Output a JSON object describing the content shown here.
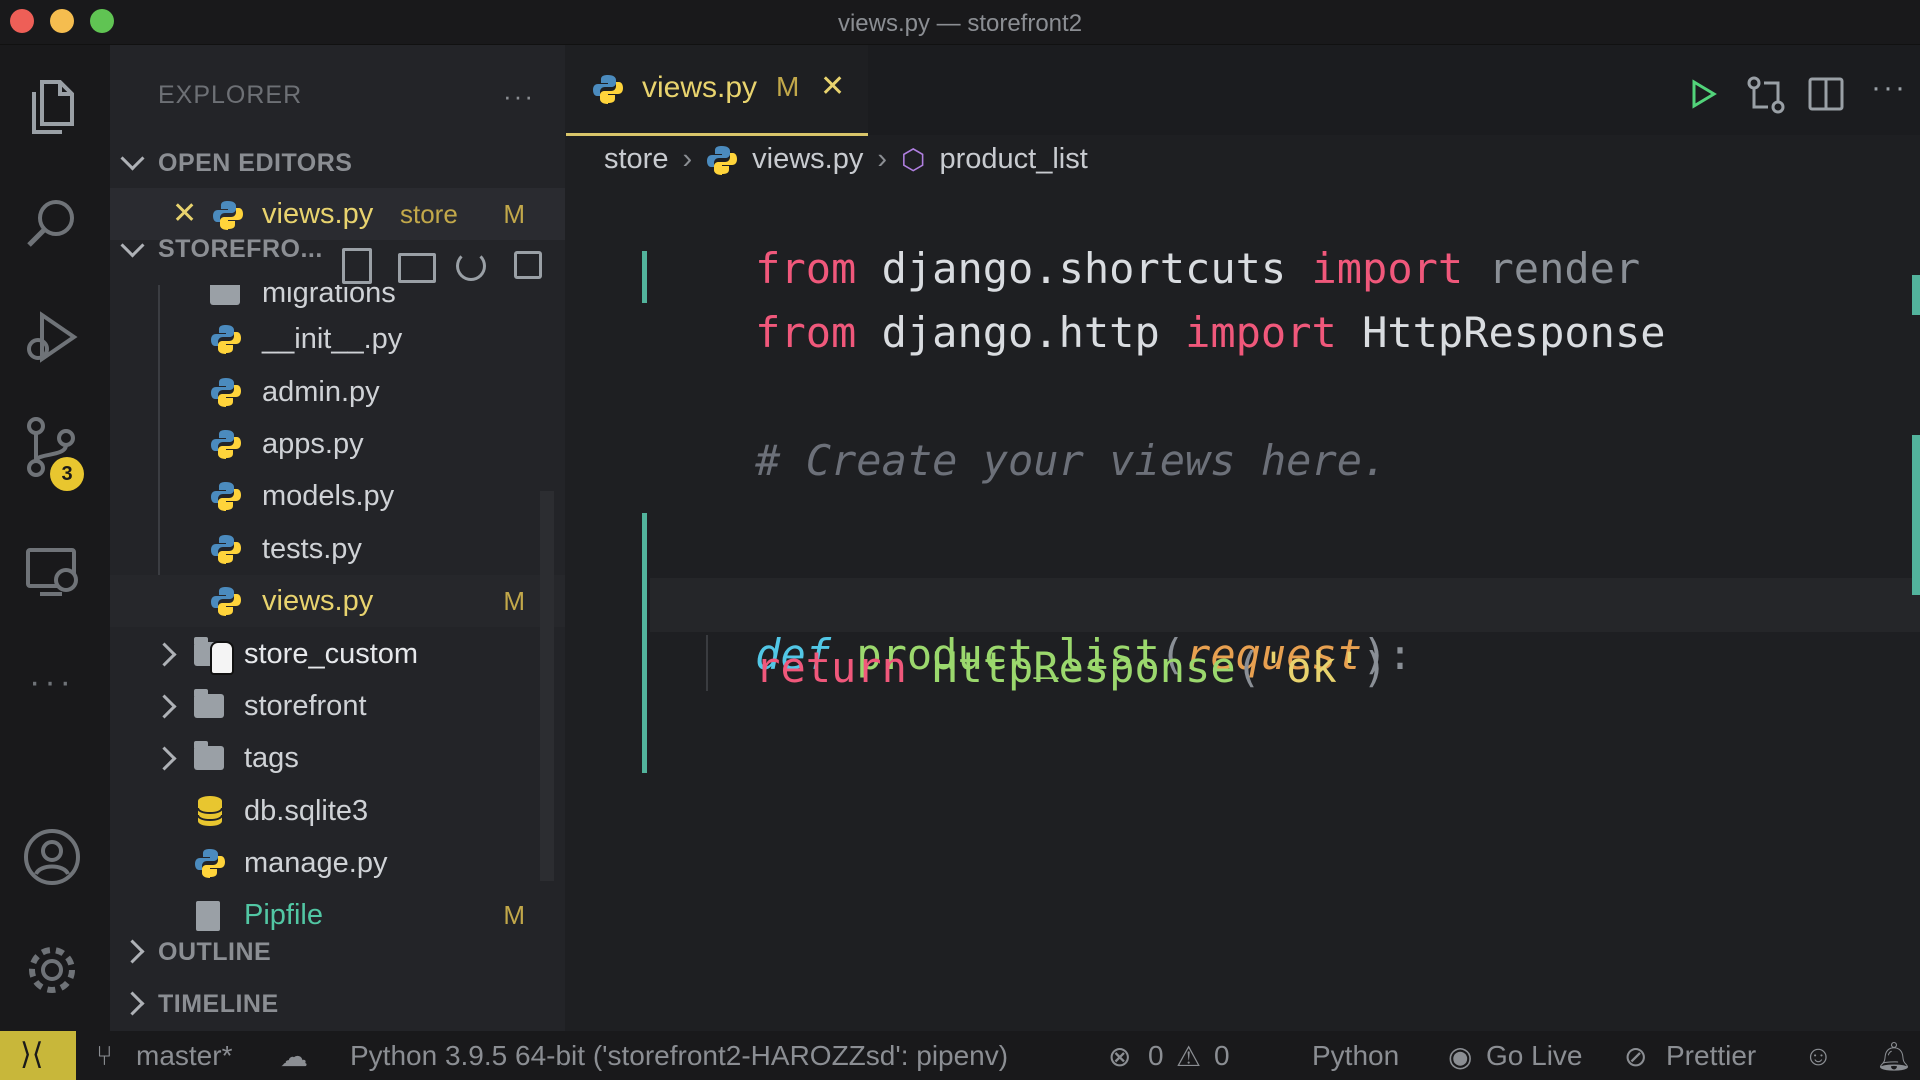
{
  "window": {
    "title": "views.py — storefront2"
  },
  "activity_bar": {
    "scm_badge": "3"
  },
  "sidebar": {
    "header": "EXPLORER",
    "more": "···",
    "open_editors": {
      "label": "OPEN EDITORS",
      "item": {
        "name": "views.py",
        "folder": "store",
        "status": "M"
      }
    },
    "project": {
      "label": "STOREFRO..."
    },
    "files": [
      {
        "name": "migrations",
        "type": "folder"
      },
      {
        "name": "__init__.py",
        "type": "python"
      },
      {
        "name": "admin.py",
        "type": "python"
      },
      {
        "name": "apps.py",
        "type": "python"
      },
      {
        "name": "models.py",
        "type": "python"
      },
      {
        "name": "tests.py",
        "type": "python"
      },
      {
        "name": "views.py",
        "type": "python",
        "status": "M"
      },
      {
        "name": "store_custom",
        "type": "folder"
      },
      {
        "name": "storefront",
        "type": "folder"
      },
      {
        "name": "tags",
        "type": "folder"
      },
      {
        "name": "db.sqlite3",
        "type": "database"
      },
      {
        "name": "manage.py",
        "type": "python"
      },
      {
        "name": "Pipfile",
        "type": "file",
        "status": "M"
      }
    ],
    "outline": "OUTLINE",
    "timeline": "TIMELINE"
  },
  "editor": {
    "tab": {
      "name": "views.py",
      "status": "M"
    },
    "breadcrumb": {
      "folder": "store",
      "file": "views.py",
      "symbol": "product_list"
    },
    "code": {
      "line1": {
        "kw1": "from",
        "mod": "django.shortcuts",
        "kw2": "import",
        "name": "render"
      },
      "line2": {
        "kw1": "from",
        "mod": "django.http",
        "kw2": "import",
        "name": "HttpResponse"
      },
      "comment": "# Create your views here.",
      "def_line": {
        "kw": "def",
        "fn": "product_list",
        "open": "(",
        "param": "request",
        "close": "):"
      },
      "return_line": {
        "kw": "return",
        "fn": "HttpResponse",
        "open": "(",
        "str": "'ok'",
        "close": ")"
      }
    }
  },
  "status_bar": {
    "branch": "master*",
    "interpreter": "Python 3.9.5 64-bit ('storefront2-HAROZZsd': pipenv)",
    "errors": "0",
    "warnings": "0",
    "language": "Python",
    "go_live": "Go Live",
    "prettier": "Prettier"
  },
  "colors": {
    "accent": "#d9c56a",
    "git_bar": "#52b39c",
    "remote": "#c8b73a"
  }
}
